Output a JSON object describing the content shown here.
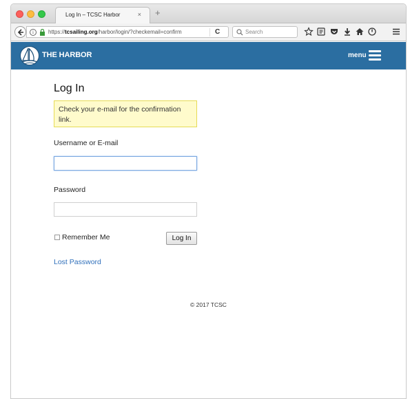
{
  "browser": {
    "tab_title": "Log In – TCSC Harbor",
    "tab_close": "×",
    "new_tab": "+",
    "url_domain": "tcsailing.org",
    "url_prefix": "https://",
    "url_path": "/harbor/login/?checkemail=confirm",
    "search_placeholder": "Search",
    "info_glyph": "i",
    "reload_glyph": "C"
  },
  "header": {
    "site_title": "THE HARBOR",
    "menu_label": "menu",
    "accent_color": "#2b6ea1"
  },
  "login": {
    "heading": "Log In",
    "notice": "Check your e-mail for the confirmation link.",
    "username_label": "Username or E-mail",
    "username_value": "",
    "password_label": "Password",
    "password_value": "",
    "remember_label": "Remember Me",
    "submit_label": "Log In",
    "lost_password": "Lost Password"
  },
  "footer": {
    "copyright": "© 2017 TCSC"
  }
}
